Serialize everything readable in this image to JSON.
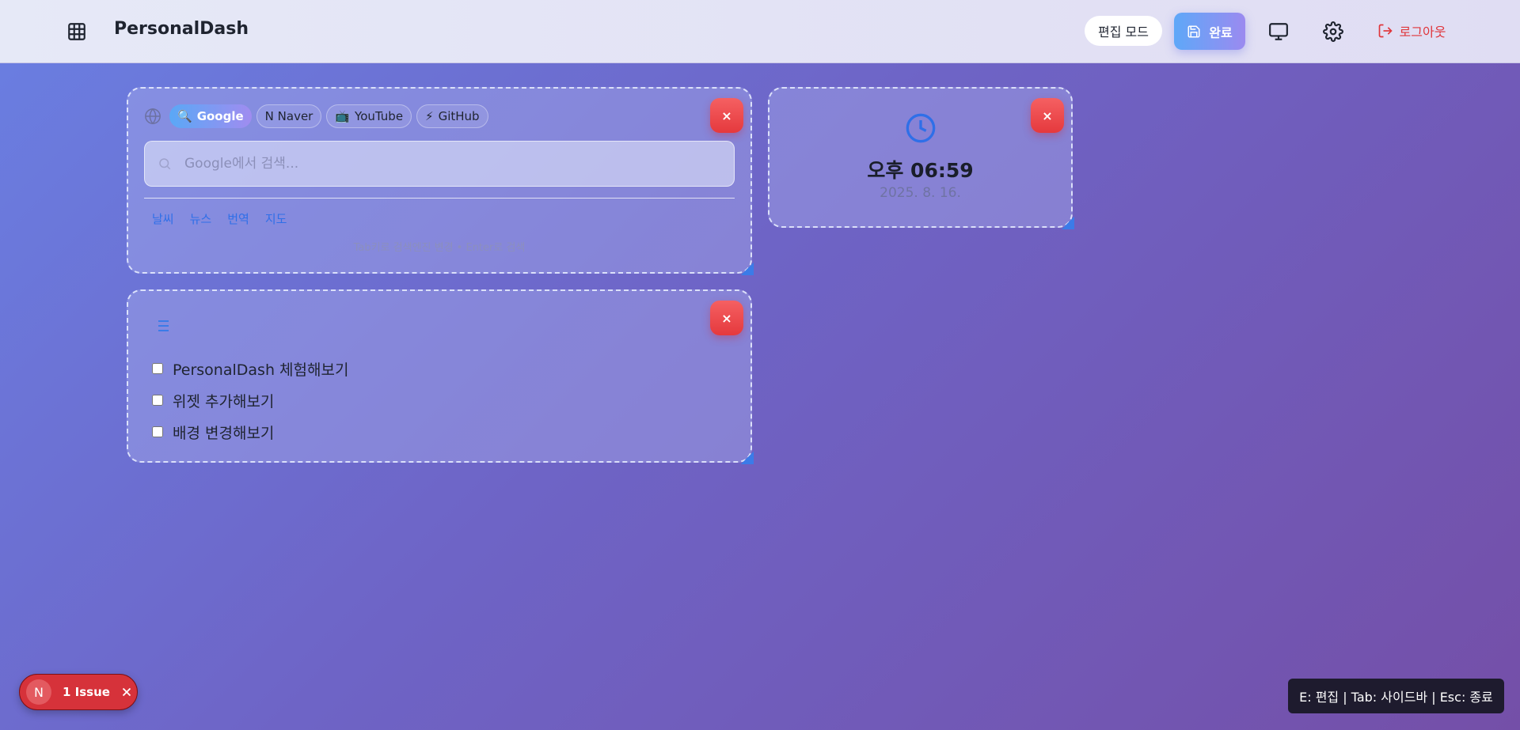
{
  "header": {
    "app_title": "PersonalDash",
    "edit_mode_label": "편집 모드",
    "done_label": "완료",
    "logout_label": "로그아웃",
    "icons": {
      "menu": "grid-icon",
      "save": "save-icon",
      "display": "monitor-icon",
      "settings": "gear-icon",
      "logout": "logout-icon"
    }
  },
  "search_widget": {
    "engines": [
      {
        "label": "Google",
        "icon": "🔍",
        "active": true
      },
      {
        "label": "N Naver",
        "icon": "",
        "active": false
      },
      {
        "label": "YouTube",
        "icon": "📺",
        "active": false
      },
      {
        "label": "GitHub",
        "icon": "⚡",
        "active": false
      }
    ],
    "placeholder": "Google에서 검색...",
    "value": "",
    "quick_links": [
      "날씨",
      "뉴스",
      "번역",
      "지도"
    ],
    "hint": "Tab키로 검색엔진 변경 • Enter로 검색",
    "close_label": "×"
  },
  "clock_widget": {
    "time": "오후 06:59",
    "date": "2025. 8. 16.",
    "close_label": "×"
  },
  "todo_widget": {
    "items": [
      {
        "label": "PersonalDash 체험해보기",
        "checked": false
      },
      {
        "label": "위젯 추가해보기",
        "checked": false
      },
      {
        "label": "배경 변경해보기",
        "checked": false
      }
    ],
    "close_label": "×"
  },
  "issue_badge": {
    "avatar_letter": "N",
    "label": "1 Issue"
  },
  "shortcut_hint": "E: 편집 | Tab: 사이드바 | Esc: 종료",
  "colors": {
    "accent_blue": "#2f6fe8",
    "danger_red": "#e5393d",
    "done_gradient_start": "#5ea8f8",
    "done_gradient_end": "#9b8af0"
  }
}
